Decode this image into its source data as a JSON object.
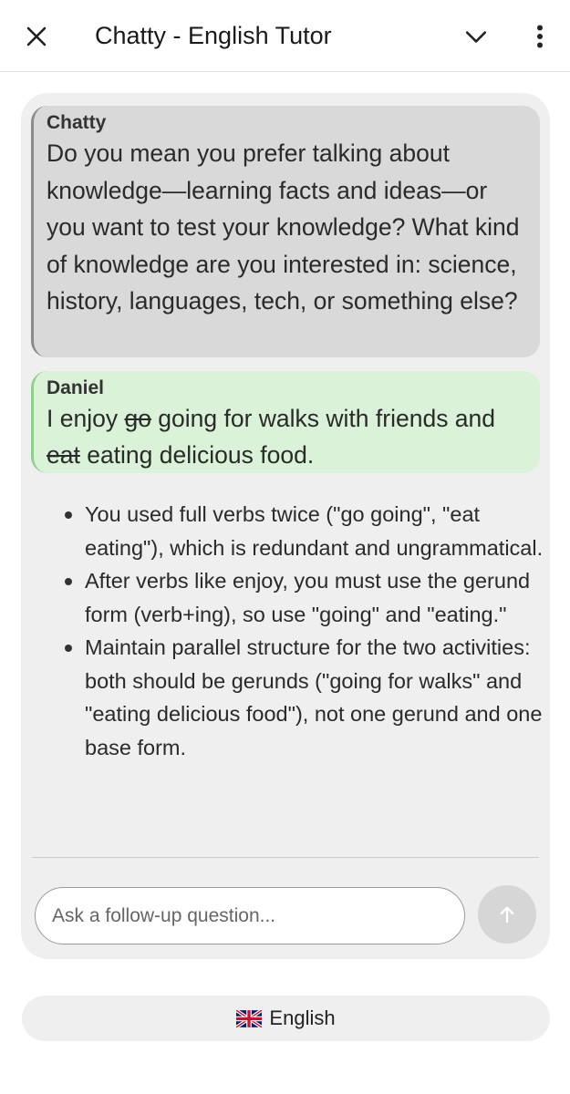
{
  "header": {
    "title": "Chatty - English Tutor",
    "icons": {
      "close": "close-icon",
      "collapse": "chevron-down-icon",
      "menu": "more-vertical-icon"
    }
  },
  "messages": [
    {
      "sender": "Chatty",
      "role": "bot",
      "text": "Do you mean you prefer talking about knowledge—learning facts and ideas—or you want to test your knowledge? What kind of knowledge are you interested in: science, history, languages, tech, or something else?"
    },
    {
      "sender": "Daniel",
      "role": "user",
      "parts": [
        {
          "text": "I enjoy ",
          "struck": false
        },
        {
          "text": "go",
          "struck": true
        },
        {
          "text": " going for walks with friends and ",
          "struck": false
        },
        {
          "text": "eat",
          "struck": true
        },
        {
          "text": " eating delicious food.",
          "struck": false
        }
      ]
    }
  ],
  "feedback": [
    "You used full verbs twice (\"go going\", \"eat eating\"), which is redundant and ungrammatical.",
    "After verbs like enjoy, you must use the gerund form (verb+ing), so use \"going\" and \"eating.\"",
    "Maintain parallel structure for the two activities: both should be gerunds (\"going for walks\" and \"eating delicious food\"), not one gerund and one base form."
  ],
  "followup": {
    "placeholder": "Ask a follow-up question...",
    "value": "",
    "send_icon": "arrow-up-icon"
  },
  "language": {
    "label": "English",
    "flag_icon": "uk-flag-icon"
  },
  "colors": {
    "bot_bubble": "#d9d9d9",
    "bot_border": "#8a8a8a",
    "user_bubble": "#d9f2d8",
    "user_border": "#8fd18c",
    "card_bg": "#efefef",
    "send_button": "#d6d6d6"
  }
}
